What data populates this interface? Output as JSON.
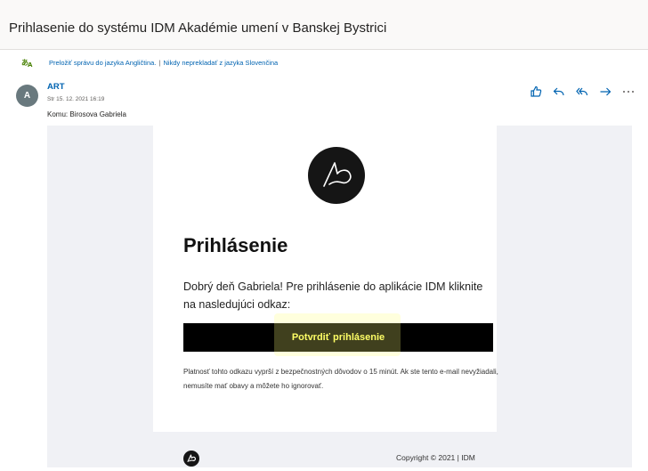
{
  "subject": "Prihlasenie do systému IDM Akadémie umení v Banskej Bystrici",
  "translate": {
    "icon": "translate-icon",
    "translate_link": "Preložiť správu do jazyka Angličtina.",
    "separator": "|",
    "never_link": "Nikdy neprekladať z jazyka Slovenčina"
  },
  "message": {
    "avatar_letter": "A",
    "sender": "ART",
    "date": "Str 15. 12. 2021 16:19",
    "to": "Komu:  Birosova Gabriela"
  },
  "actions": {
    "like": "like-icon",
    "reply": "reply-icon",
    "reply_all": "reply-all-icon",
    "forward": "forward-icon",
    "more": "more-icon"
  },
  "email": {
    "heading": "Prihlásenie",
    "greeting": "Dobrý deň Gabriela! Pre prihlásenie do aplikácie IDM kliknite na nasledujúci odkaz:",
    "button_label": "Potvrdiť prihlásenie",
    "note": "Platnosť tohto odkazu vyprší z bezpečnostných dôvodov o 15 minút. Ak ste tento e-mail nevyžiadali, nemusíte mať obavy a môžete ho ignorovať.",
    "copyright": "Copyright © 2021  |  IDM"
  },
  "colors": {
    "link": "#0063b1",
    "button_bg": "#000000",
    "button_text": "#ffff66",
    "highlight": "#ffff78"
  }
}
